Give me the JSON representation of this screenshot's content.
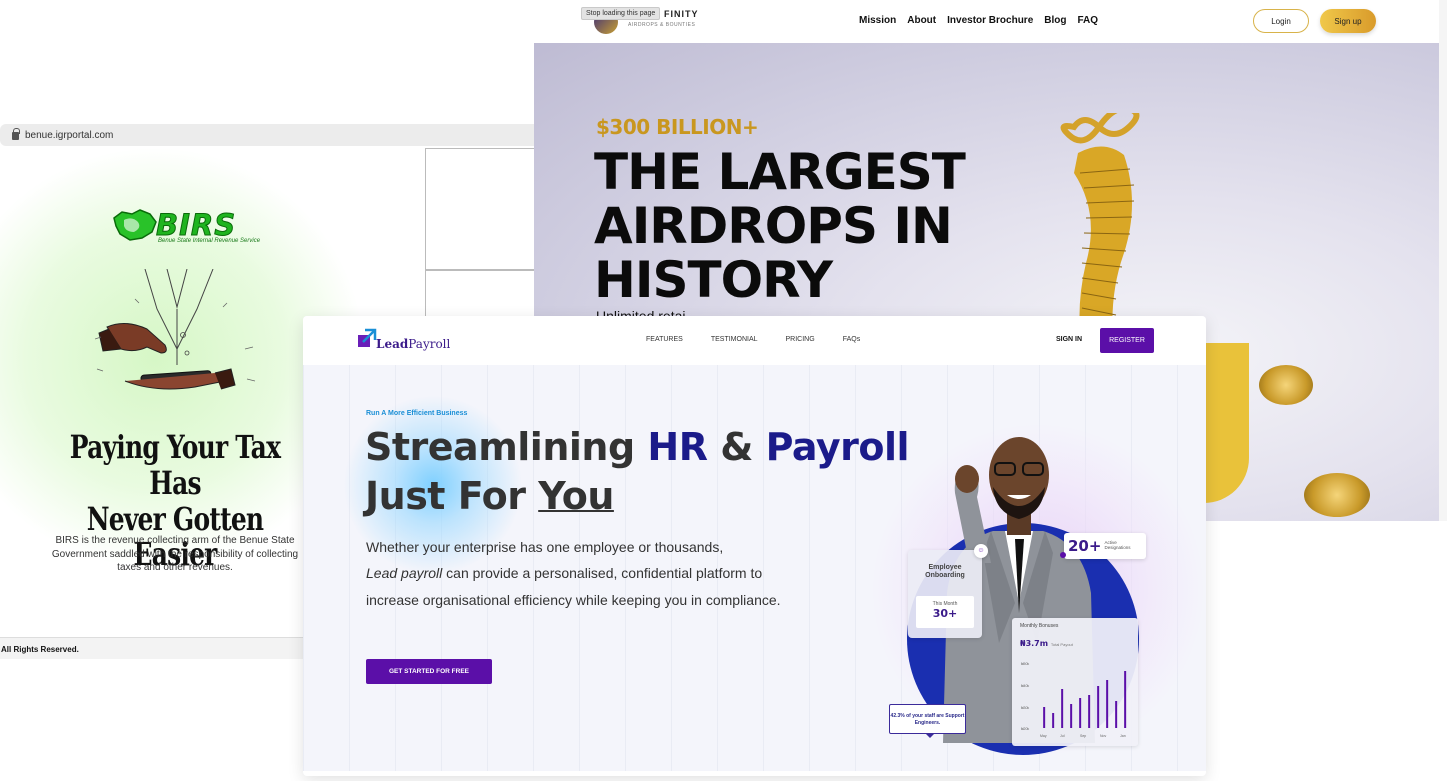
{
  "birs": {
    "url": "benue.igrportal.com",
    "logo_word": "BIRS",
    "logo_sub": "Benue State Internal Revenue Service",
    "headline_line1": "Paying Your Tax Has",
    "headline_line2": "Never Gotten Easier",
    "description": "BIRS is the revenue collecting arm of the Benue State Government saddled with the responsibility of collecting taxes and other revenues.",
    "footer": "All Rights Reserved."
  },
  "infinity": {
    "tooltip": "Stop loading this page",
    "brand": "FINITY",
    "brand_sub": "AIRDROPS & BOUNTIES",
    "menu": [
      "Mission",
      "About",
      "Investor Brochure",
      "Blog",
      "FAQ"
    ],
    "login": "Login",
    "signup": "Sign up",
    "kicker": "$300 BILLION+",
    "title_line1": "THE LARGEST",
    "title_line2": "AIRDROPS IN",
    "title_line3": "HISTORY",
    "subtitle": "Unlimited retai"
  },
  "leadpayroll": {
    "logo_bold": "Lead",
    "logo_regular": "Payroll",
    "menu": [
      "FEATURES",
      "TESTIMONIAL",
      "PRICING",
      "FAQs"
    ],
    "signin": "SIGN IN",
    "register": "REGISTER",
    "kicker": "Run A More Efficient Business",
    "title_part1": "Streamlining ",
    "title_accent1": "HR",
    "title_part2": " & ",
    "title_accent2": "Payroll",
    "title_line2a": "Just For ",
    "title_line2b": "You",
    "desc_part1": "Whether your enterprise has one employee or thousands,",
    "desc_italic": "Lead payroll",
    "desc_part2": " can provide a personalised, confidential platform to increase organisational efficiency while keeping you in compliance.",
    "cta": "GET STARTED FOR FREE",
    "count_value": "20+",
    "count_label1": "Active",
    "count_label2": "Designations",
    "onboarding_title1": "Employee",
    "onboarding_title2": "Onboarding",
    "onboarding_period": "This Month",
    "onboarding_value": "30+",
    "bonus_title": "Monthly Bonuses",
    "bonus_value": "₦3.7m",
    "bonus_value_note": "Total Payout",
    "bonus_y_labels": [
      "₦50k",
      "₦40k",
      "₦30k",
      "₦20k"
    ],
    "bonus_x_labels": [
      "May",
      "Jul",
      "Sep",
      "Nov",
      "Jan"
    ],
    "bonus_bars": [
      0.35,
      0.25,
      0.65,
      0.4,
      0.5,
      0.55,
      0.7,
      0.8,
      0.45,
      0.95
    ],
    "note": "42.3% of your staff are Support Engineers."
  },
  "colors": {
    "birs_green": "#1fb41f",
    "infinity_gold": "#c9971f",
    "lp_purple": "#5b0fa8",
    "lp_navy": "#1b1b8a",
    "lp_kicker": "#1a8fd6"
  }
}
